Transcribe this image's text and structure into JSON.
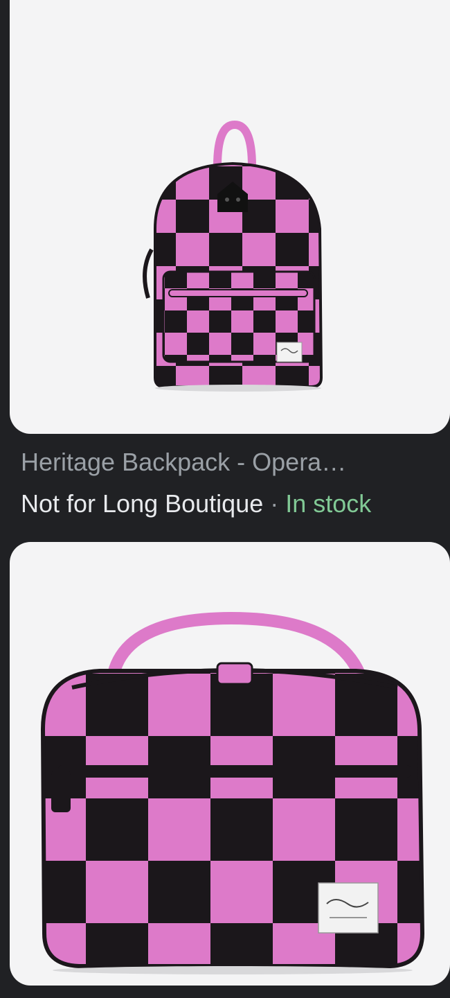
{
  "results": [
    {
      "image_alt": "Pink and black checkered kids backpack",
      "title": "Heritage Backpack - Opera…",
      "store": "Not for Long Boutique",
      "separator": " · ",
      "stock": "In stock",
      "colors": {
        "pink": "#dd7ac9",
        "black": "#1b171b",
        "stock": "#81c995"
      }
    },
    {
      "image_alt": "Pink and black checkered lunch box"
    }
  ]
}
